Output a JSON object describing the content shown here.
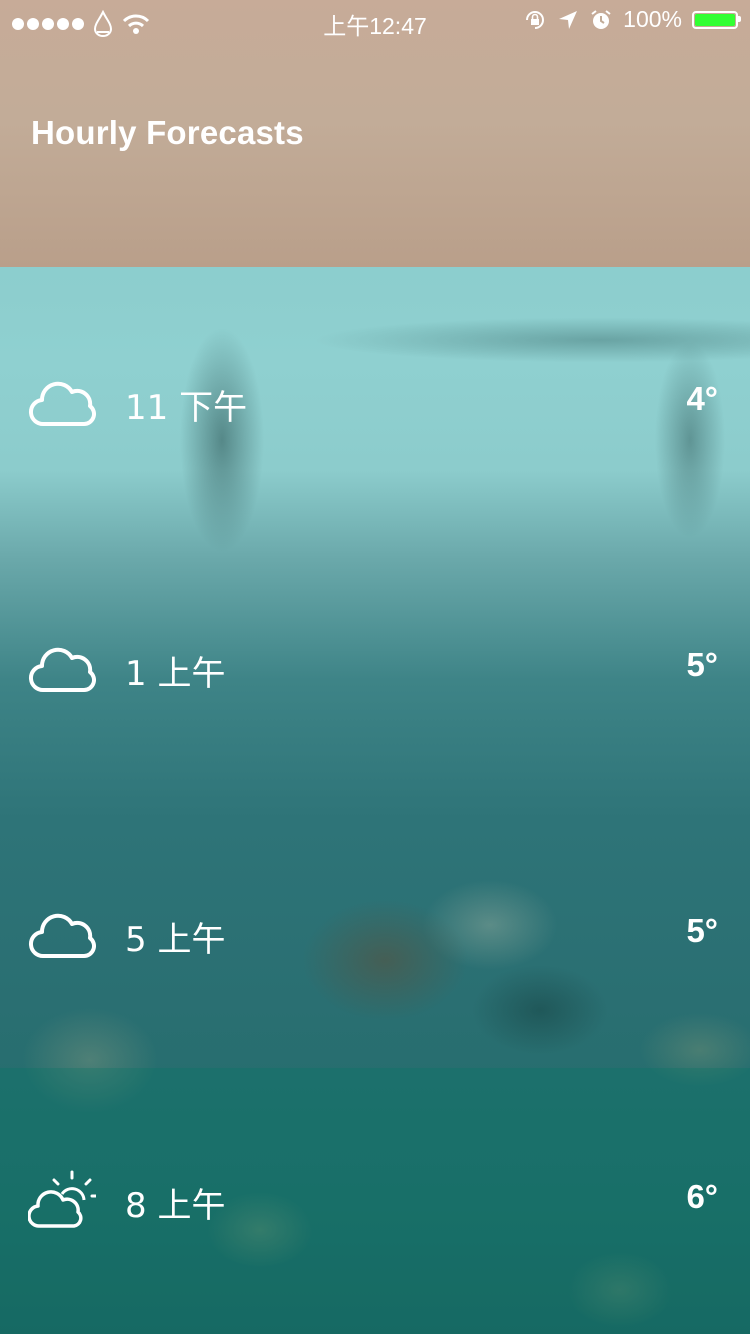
{
  "status_bar": {
    "signal_dots": 5,
    "time": "上午12:47",
    "battery_percent": "100%",
    "battery_color": "#33ff33",
    "icons": [
      "signal-dots-icon",
      "carrier-drop-icon",
      "wifi-icon",
      "orientation-lock-icon",
      "location-arrow-icon",
      "alarm-icon",
      "battery-icon"
    ]
  },
  "header": {
    "title": "Hourly Forecasts"
  },
  "forecasts": [
    {
      "time": "11 下午",
      "temp": "4°",
      "icon": "cloud-icon"
    },
    {
      "time": "1 上午",
      "temp": "5°",
      "icon": "cloud-icon"
    },
    {
      "time": "5 上午",
      "temp": "5°",
      "icon": "cloud-icon"
    },
    {
      "time": "8 上午",
      "temp": "6°",
      "icon": "partly-sunny-icon"
    }
  ]
}
